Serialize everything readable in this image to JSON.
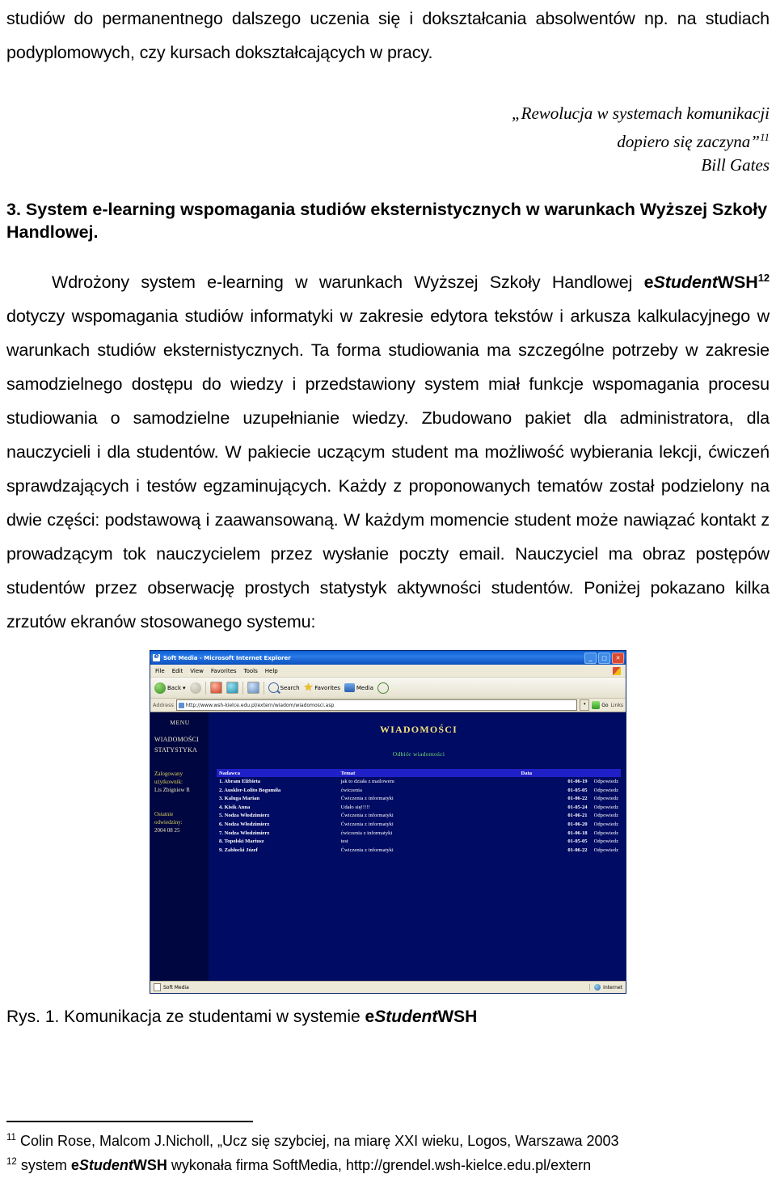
{
  "document": {
    "top_paragraph": "studiów do permanentnego dalszego uczenia się i dokształcania absolwentów np. na studiach podyplomowych, czy kursach dokształcających w pracy.",
    "quote": {
      "line1": "„Rewolucja w systemach komunikacji",
      "line2": "dopiero się zaczyna”",
      "line2_sup": "11",
      "author": "Bill Gates"
    },
    "section_heading": "3. System e-learning wspomagania studiów eksternistycznych w warunkach Wyższej Szkoły Handlowej.",
    "body": {
      "p1_before": "Wdrożony system e-learning w warunkach Wyższej Szkoły Handlowej ",
      "brand_e": "e",
      "brand_student": "Student",
      "brand_wsh": "WSH",
      "footnote_marker": "12",
      "p1_after": " dotyczy wspomagania studiów informatyki w zakresie edytora tekstów i arkusza kalkulacyjnego w warunkach studiów eksternistycznych. Ta forma studiowania ma szczególne potrzeby w zakresie samodzielnego dostępu do wiedzy i przedstawiony system miał funkcje wspomagania procesu studiowania o samodzielne uzupełnianie wiedzy. Zbudowano pakiet dla administratora, dla nauczycieli i dla studentów. W pakiecie uczącym student ma możliwość wybierania lekcji, ćwiczeń sprawdzających i testów egzaminujących. Każdy z proponowanych tematów został podzielony na dwie części: podstawową i zaawansowaną. W każdym momencie student może nawiązać kontakt z prowadzącym tok nauczycielem przez wysłanie poczty email. Nauczyciel ma obraz postępów studentów przez obserwację prostych statystyk aktywności studentów. Poniżej pokazano kilka zrzutów ekranów stosowanego systemu:"
    },
    "figure_caption": {
      "prefix": "Rys. 1. Komunikacja ze studentami w systemie ",
      "brand_e": "e",
      "brand_student": "Student",
      "brand_wsh": "WSH"
    },
    "footnotes": [
      {
        "marker": "11",
        "text": "Colin Rose, Malcom J.Nicholl, „Ucz się szybciej, na miarę XXI wieku, Logos, Warszawa 2003"
      },
      {
        "marker": "12",
        "prefix": "system ",
        "brand_e": "e",
        "brand_student": "Student",
        "brand_wsh": "WSH",
        "suffix": " wykonała firma SoftMedia, http://grendel.wsh-kielce.edu.pl/extern"
      }
    ]
  },
  "screenshot": {
    "window_title": "Soft Media - Microsoft Internet Explorer",
    "window_buttons": {
      "minimize": "_",
      "maximize": "□",
      "close": "✕"
    },
    "menus": [
      "File",
      "Edit",
      "View",
      "Favorites",
      "Tools",
      "Help"
    ],
    "toolbar": {
      "back": "Back",
      "back_caret": "▾",
      "forward": "",
      "stop": "",
      "refresh": "",
      "home": "",
      "search": "Search",
      "favorites": "Favorites",
      "media": "Media",
      "history": ""
    },
    "address_bar": {
      "label": "Address",
      "url": "http://www.wsh-kielce.edu.pl/extern/wiadom/wiadomosci.asp",
      "dropdown_caret": "▾",
      "go_label": "Go",
      "links_label": "Links"
    },
    "sidebar": {
      "menu_title": "MENU",
      "items": [
        "WIADOMOŚCI",
        "STATYSTYKA"
      ],
      "logged_label_1": "Zalogowany",
      "logged_label_2": "użytkownik:",
      "logged_user": "Lis Zbigniew R",
      "last_visit_label_1": "Ostatnie",
      "last_visit_label_2": "odwiedziny:",
      "last_visit_value": "2004 08 25"
    },
    "page": {
      "title": "WIADOMOŚCI",
      "subtitle": "Odbiór wiadomości",
      "table": {
        "headers": [
          "Nadawca",
          "Temat",
          "Data"
        ],
        "reply_label": "Odpowiedz",
        "rows": [
          {
            "no": "1.",
            "from": "Abram Elżbieta",
            "subject": "jak to działa z mailowem",
            "date": "01-06-19"
          },
          {
            "no": "2.",
            "from": "Auskler-Lolito Bogumiła",
            "subject": "ćwiczenia",
            "date": "01-05-05"
          },
          {
            "no": "3.",
            "from": "Kaluga Marian",
            "subject": "Ćwiczenia z informatyki",
            "date": "01-06-22"
          },
          {
            "no": "4.",
            "from": "Kisik Anna",
            "subject": "Udało się!!!!!",
            "date": "01-05-24"
          },
          {
            "no": "5.",
            "from": "Nodza Włodzimierz",
            "subject": "Ćwiczenia z informatyki",
            "date": "01-06-21"
          },
          {
            "no": "6.",
            "from": "Nodza Włodzimierz",
            "subject": "Ćwiczenia z informatyki",
            "date": "01-06-20"
          },
          {
            "no": "7.",
            "from": "Nodza Włodzimierz",
            "subject": "ćwiczenia z informatyki",
            "date": "01-06-18"
          },
          {
            "no": "8.",
            "from": "Topolski Mariusz",
            "subject": "test",
            "date": "01-05-05"
          },
          {
            "no": "9.",
            "from": "Zabłocki Józef",
            "subject": "Ćwiczenia z informatyki",
            "date": "01-06-22"
          }
        ]
      }
    },
    "statusbar": {
      "left_text": "Soft Media",
      "zone": "Internet"
    }
  }
}
